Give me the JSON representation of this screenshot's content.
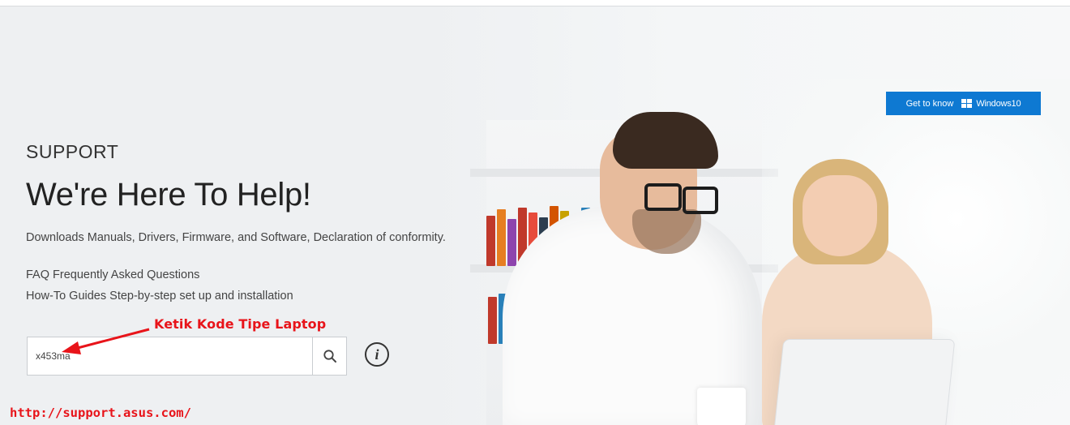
{
  "hero": {
    "kicker": "SUPPORT",
    "headline": "We're Here To Help!",
    "lines": [
      "Downloads Manuals, Drivers, Firmware, and Software, Declaration of conformity.",
      "FAQ Frequently Asked Questions",
      "How-To Guides Step-by-step set up and installation"
    ]
  },
  "search": {
    "value": "x453ma",
    "button_icon": "search-icon"
  },
  "info": {
    "icon": "info-icon",
    "glyph": "i"
  },
  "windows_badge": {
    "label": "Get to know",
    "brand": "Windows10",
    "icon": "windows-logo-icon",
    "color": "#0e79d2"
  },
  "annotations": {
    "hint": "Ketik Kode Tipe Laptop",
    "url": "http://support.asus.com/",
    "color": "#e8141a"
  }
}
